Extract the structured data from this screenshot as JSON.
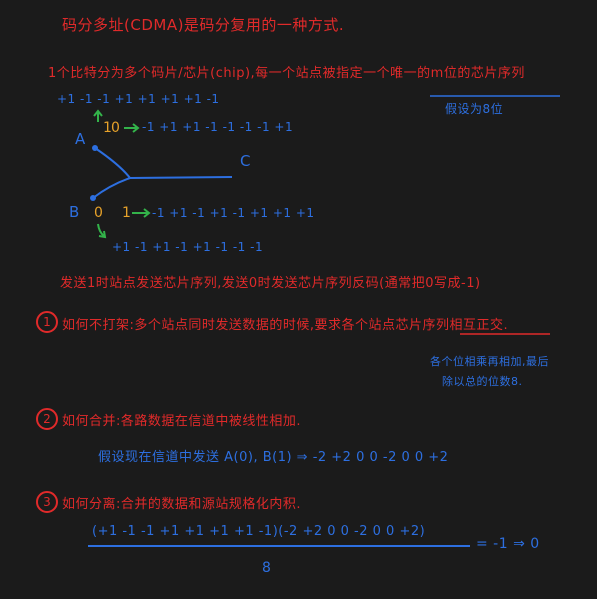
{
  "title": "码分多址(CDMA)是码分复用的一种方式.",
  "line2": "1个比特分为多个码片/芯片(chip),每一个站点被指定一个唯一的m位的芯片序列",
  "assume8": "假设为8位",
  "seq_top": "+1 -1 -1 +1 +1 +1 +1 -1",
  "node_a": "A",
  "node_b": "B",
  "node_c": "C",
  "bit_a": "1",
  "bit_a0": "0",
  "seq_a1": "-1 +1 +1 -1 -1 -1 -1 +1",
  "bit_b0": "0",
  "bit_b1": "1",
  "seq_b1": "-1 +1 -1 +1 -1 +1 +1 +1",
  "seq_b0": "+1 -1 +1 -1 +1 -1 -1 -1",
  "send_rule": "发送1时站点发送芯片序列,发送0时发送芯片序列反码(通常把0写成-1)",
  "q1_num": "1",
  "q1": "如何不打架:多个站点同时发送数据的时候,要求各个站点芯片序列相互正交.",
  "q1_note_1": "各个位相乘再相加,最后",
  "q1_note_2": "除以总的位数8.",
  "q2_num": "2",
  "q2": "如何合并:各路数据在信道中被线性相加.",
  "q2_example": "假设现在信道中发送 A(0), B(1) ⇒ -2 +2 0 0 -2 0 0 +2",
  "q3_num": "3",
  "q3": "如何分离:合并的数据和源站规格化内积.",
  "q3_numerator": "(+1 -1 -1 +1 +1 +1 +1 -1)(-2 +2 0 0 -2 0 0 +2)",
  "q3_result": "= -1 ⇒ 0",
  "q3_denominator": "8"
}
